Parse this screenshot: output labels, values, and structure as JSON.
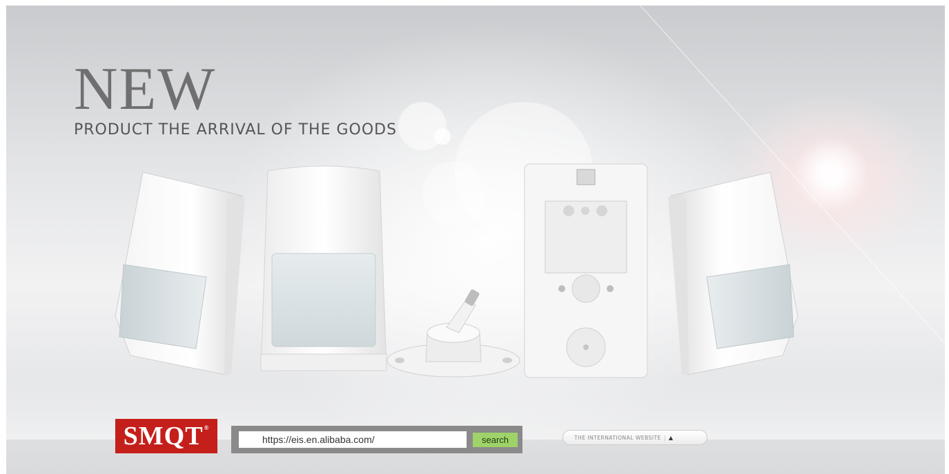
{
  "hero": {
    "headline": "NEW",
    "tagline": "PRODUCT THE ARRIVAL OF THE GOODS"
  },
  "brand": {
    "logo_text": "SMQT",
    "logo_mark": "®",
    "color": "#c41f1a"
  },
  "search": {
    "value": "https://eis.en.alibaba.com/",
    "button_label": "search",
    "button_color": "#9fd36a"
  },
  "international": {
    "label": "THE INTERNATIONAL WEBSITE",
    "separator": "|",
    "arrow_icon": "▲"
  },
  "products": [
    {
      "icon": "pir-sensor-angled-left"
    },
    {
      "icon": "pir-sensor-front"
    },
    {
      "icon": "sensor-wall-bracket"
    },
    {
      "icon": "sensor-back-plate"
    },
    {
      "icon": "pir-sensor-angled-right"
    }
  ]
}
